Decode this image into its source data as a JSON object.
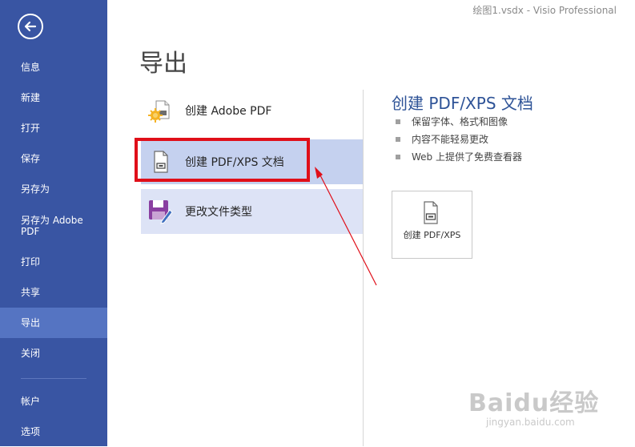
{
  "window": {
    "title": "绘图1.vsdx - Visio Professional"
  },
  "sidebar": {
    "back_icon": "back-arrow-icon",
    "items": [
      {
        "label": "信息"
      },
      {
        "label": "新建"
      },
      {
        "label": "打开"
      },
      {
        "label": "保存"
      },
      {
        "label": "另存为"
      },
      {
        "label": "另存为 Adobe PDF"
      },
      {
        "label": "打印"
      },
      {
        "label": "共享"
      },
      {
        "label": "导出",
        "active": true
      },
      {
        "label": "关闭"
      },
      {
        "label": "帐户"
      },
      {
        "label": "选项"
      }
    ]
  },
  "main": {
    "title": "导出",
    "options": [
      {
        "label": "创建 Adobe PDF",
        "icon": "adobe-pdf-icon"
      },
      {
        "label": "创建 PDF/XPS 文档",
        "icon": "pdf-xps-document-icon",
        "selected": true
      },
      {
        "label": "更改文件类型",
        "icon": "change-file-type-icon"
      }
    ]
  },
  "detail": {
    "title": "创建 PDF/XPS 文档",
    "bullets": [
      "保留字体、格式和图像",
      "内容不能轻易更改",
      "Web 上提供了免费查看器"
    ],
    "button_label": "创建 PDF/XPS"
  },
  "watermark": {
    "main": "Baidu经验",
    "sub": "jingyan.baidu.com"
  },
  "colors": {
    "sidebar": "#3955a3",
    "sidebar_active": "#5574c2",
    "selected_option": "#c5d1ef",
    "hover_option": "#dde3f6",
    "highlight": "#e00f19",
    "detail_title": "#2e5397"
  }
}
